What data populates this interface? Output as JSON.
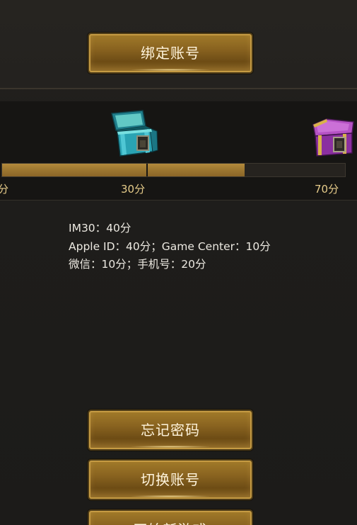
{
  "bind_button": {
    "label": "绑定账号"
  },
  "progress": {
    "current_fraction": 0.708,
    "ticks": [
      {
        "label": "分"
      },
      {
        "label": "30分"
      },
      {
        "label": "70分"
      }
    ],
    "chests": [
      {
        "icon": "teal-chest-open-icon",
        "tier": "30分",
        "color": "#2fa6b5"
      },
      {
        "icon": "purple-chest-icon",
        "tier": "70分",
        "color": "#9b3fb0"
      }
    ]
  },
  "rules": {
    "line1": "IM30：40分",
    "line2": "Apple ID：40分；Game Center：10分",
    "line3": "微信：10分；手机号：20分"
  },
  "actions": {
    "forgot_password": "忘记密码",
    "switch_account": "切换账号",
    "new_game": "开始新游戏"
  },
  "colors": {
    "gold_button": "#8a6420",
    "gold_text": "#e6cc8a",
    "progress_fill": "#9c7630"
  }
}
